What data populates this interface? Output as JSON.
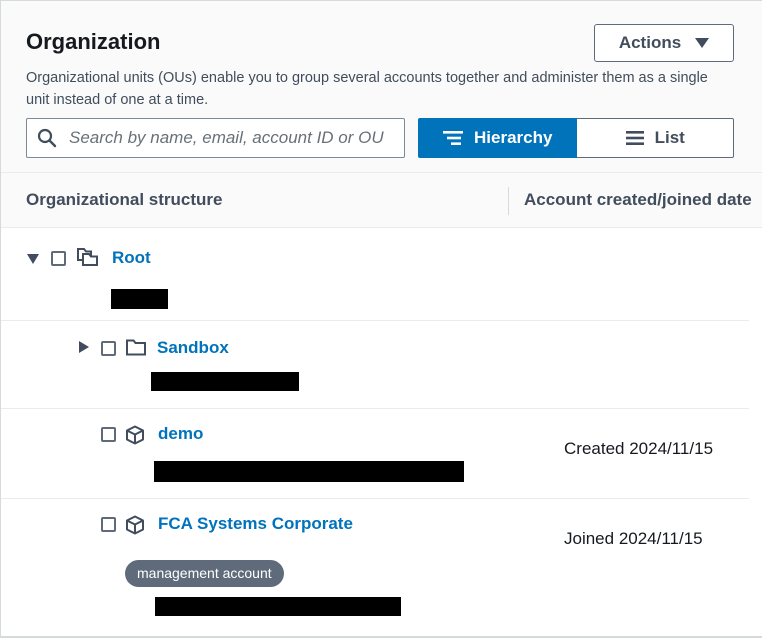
{
  "header": {
    "title": "Organization",
    "description": "Organizational units (OUs) enable you to group several accounts together and administer them as a single unit instead of one at a time.",
    "actions_label": "Actions"
  },
  "search": {
    "placeholder": "Search by name, email, account ID or OU ID",
    "value": ""
  },
  "view_toggle": {
    "hierarchy_label": "Hierarchy",
    "list_label": "List",
    "selected": "Hierarchy"
  },
  "table": {
    "columns": [
      "Organizational structure",
      "Account created/joined date"
    ],
    "rows": [
      {
        "name": "Root",
        "type": "root",
        "expanded": true,
        "date": ""
      },
      {
        "name": "Sandbox",
        "type": "ou",
        "expanded": false,
        "date": ""
      },
      {
        "name": "demo",
        "type": "account",
        "date": "Created 2024/11/15"
      },
      {
        "name": "FCA Systems Corporate",
        "type": "account",
        "badge": "management account",
        "date": "Joined 2024/11/15"
      }
    ]
  },
  "colors": {
    "accent": "#0073bb",
    "text": "#16191f",
    "muted": "#414d5c",
    "badge_bg": "#5f6b7a"
  }
}
